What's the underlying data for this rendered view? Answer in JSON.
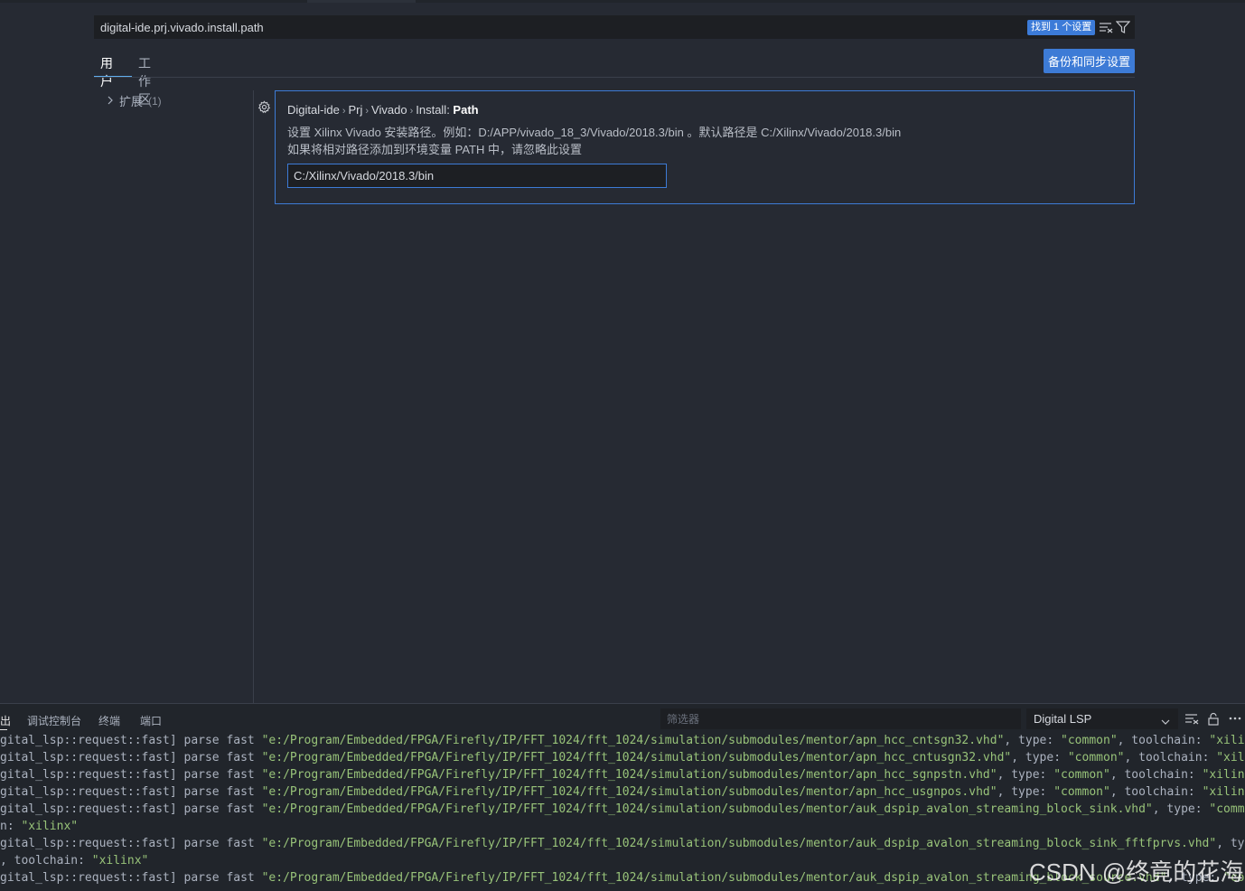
{
  "search": {
    "value": "digital-ide.prj.vivado.install.path",
    "found_badge": "找到 1 个设置",
    "clear_filter_icon": "clear-filter-icon",
    "filter_icon": "filter-icon"
  },
  "tabs": [
    {
      "label": "用户",
      "active": true
    },
    {
      "label": "工作区",
      "active": false
    }
  ],
  "sync_button": "备份和同步设置",
  "tree": {
    "item_label": "扩展",
    "item_count": "(1)"
  },
  "setting": {
    "title_parts": [
      "Digital-ide",
      "Prj",
      "Vivado",
      "Install: "
    ],
    "title_bold": "Path",
    "desc_line1": "设置 Xilinx Vivado 安装路径。例如：D:/APP/vivado_18_3/Vivado/2018.3/bin 。默认路径是 C:/Xilinx/Vivado/2018.3/bin",
    "desc_line2": "如果将相对路径添加到环境变量 PATH 中，请忽略此设置",
    "value": "C:/Xilinx/Vivado/2018.3/bin"
  },
  "panel": {
    "tabs": [
      "出",
      "调试控制台",
      "终端",
      "端口"
    ],
    "filter_placeholder": "筛选器",
    "channel": "Digital LSP",
    "log_lines": [
      {
        "prefix": "gital_lsp::request::fast] parse fast ",
        "path": "\"e:/Program/Embedded/FPGA/Firefly/IP/FFT_1024/fft_1024/simulation/submodules/mentor/apn_hcc_cntsgn32.vhd\"",
        "rest1": ", type: ",
        "type": "\"common\"",
        "rest2": ", toolchain: ",
        "toolchain": "\"xilinx\""
      },
      {
        "prefix": "gital_lsp::request::fast] parse fast ",
        "path": "\"e:/Program/Embedded/FPGA/Firefly/IP/FFT_1024/fft_1024/simulation/submodules/mentor/apn_hcc_cntusgn32.vhd\"",
        "rest1": ", type: ",
        "type": "\"common\"",
        "rest2": ", toolchain: ",
        "toolchain": "\"xilinx"
      },
      {
        "prefix": "gital_lsp::request::fast] parse fast ",
        "path": "\"e:/Program/Embedded/FPGA/Firefly/IP/FFT_1024/fft_1024/simulation/submodules/mentor/apn_hcc_sgnpstn.vhd\"",
        "rest1": ", type: ",
        "type": "\"common\"",
        "rest2": ", toolchain: ",
        "toolchain": "\"xilinx\""
      },
      {
        "prefix": "gital_lsp::request::fast] parse fast ",
        "path": "\"e:/Program/Embedded/FPGA/Firefly/IP/FFT_1024/fft_1024/simulation/submodules/mentor/apn_hcc_usgnpos.vhd\"",
        "rest1": ", type: ",
        "type": "\"common\"",
        "rest2": ", toolchain: ",
        "toolchain": "\"xilinx\""
      },
      {
        "prefix": "gital_lsp::request::fast] parse fast ",
        "path": "\"e:/Program/Embedded/FPGA/Firefly/IP/FFT_1024/fft_1024/simulation/submodules/mentor/auk_dspip_avalon_streaming_block_sink.vhd\"",
        "rest1": ", type: ",
        "type": "\"common\"",
        "rest2": "",
        "toolchain": ""
      },
      {
        "prefix": "n: ",
        "path": "",
        "rest1": "",
        "type": "\"xilinx\"",
        "rest2": "",
        "toolchain": ""
      },
      {
        "prefix": "gital_lsp::request::fast] parse fast ",
        "path": "\"e:/Program/Embedded/FPGA/Firefly/IP/FFT_1024/fft_1024/simulation/submodules/mentor/auk_dspip_avalon_streaming_block_sink_fftfprvs.vhd\"",
        "rest1": ", type:",
        "type": "",
        "rest2": "",
        "toolchain": ""
      },
      {
        "prefix": ", toolchain: ",
        "path": "",
        "rest1": "",
        "type": "\"xilinx\"",
        "rest2": "",
        "toolchain": ""
      },
      {
        "prefix": "gital_lsp::request::fast] parse fast ",
        "path": "\"e:/Program/Embedded/FPGA/Firefly/IP/FFT_1024/fft_1024/simulation/submodules/mentor/auk_dspip_avalon_streaming_block_source.vhd\"",
        "rest1": ", type: ",
        "type": "\"commo",
        "rest2": "",
        "toolchain": ""
      }
    ]
  },
  "watermark": "CSDN @终竟的花海",
  "colors": {
    "background": "#262a33",
    "accent": "#3d7bd6",
    "string": "#98c379"
  }
}
